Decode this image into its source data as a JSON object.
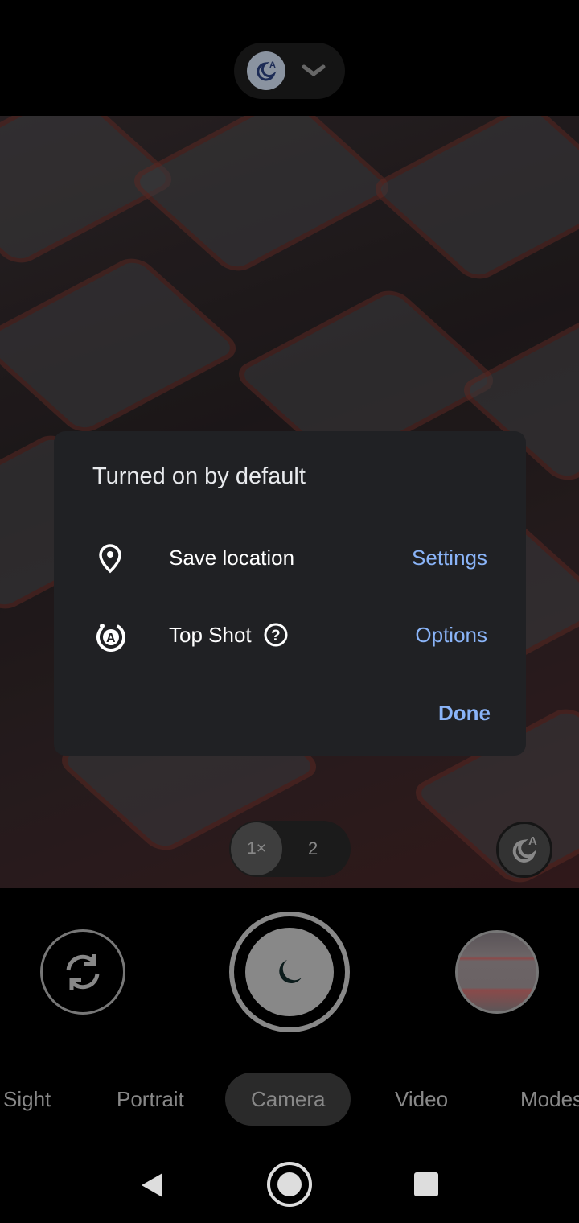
{
  "top_bar": {
    "mode_icon": "night-auto-icon",
    "expand_icon": "chevron-down-icon"
  },
  "dialog": {
    "title": "Turned on by default",
    "rows": [
      {
        "icon": "location-pin-icon",
        "label": "Save location",
        "action": "Settings"
      },
      {
        "icon": "top-shot-icon",
        "label": "Top Shot",
        "help_icon": "help-circle-icon",
        "action": "Options"
      }
    ],
    "done_label": "Done"
  },
  "zoom": {
    "options": [
      "1×",
      "2"
    ],
    "selected": "1×"
  },
  "controls": {
    "switch_camera_icon": "switch-camera-icon",
    "shutter_icon": "night-moon-icon",
    "night_toggle_icon": "night-auto-icon",
    "gallery_thumbnail": "thumbnail"
  },
  "modes": {
    "items": [
      "Sight",
      "Portrait",
      "Camera",
      "Video",
      "Modes"
    ],
    "active": "Camera"
  },
  "navbar": {
    "back": "back-icon",
    "home": "home-icon",
    "recents": "recents-icon"
  },
  "colors": {
    "accent": "#8ab4f8",
    "dialog_bg": "#202124"
  }
}
